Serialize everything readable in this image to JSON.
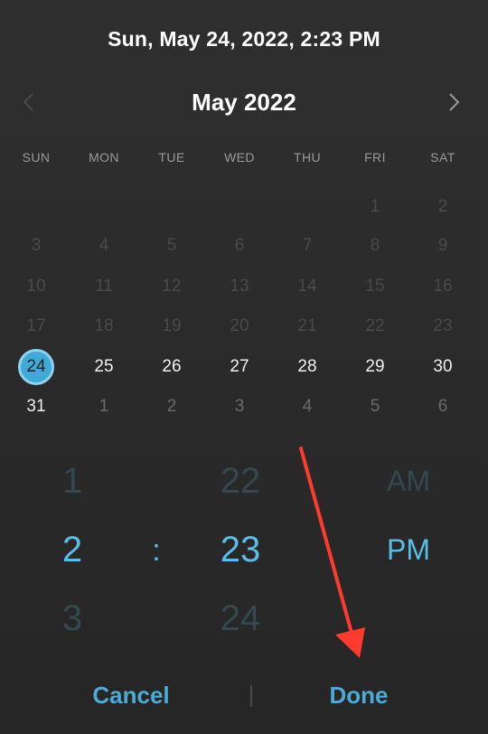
{
  "header": {
    "selected_datetime": "Sun, May 24, 2022, 2:23 PM"
  },
  "calendar": {
    "month_title": "May 2022",
    "weekdays": [
      "SUN",
      "MON",
      "TUE",
      "WED",
      "THU",
      "FRI",
      "SAT"
    ],
    "weeks": [
      [
        {
          "d": "",
          "s": "empty"
        },
        {
          "d": "",
          "s": "empty"
        },
        {
          "d": "",
          "s": "empty"
        },
        {
          "d": "",
          "s": "empty"
        },
        {
          "d": "",
          "s": "empty"
        },
        {
          "d": "1",
          "s": "dim"
        },
        {
          "d": "2",
          "s": "dim"
        }
      ],
      [
        {
          "d": "3",
          "s": "dim"
        },
        {
          "d": "4",
          "s": "dim"
        },
        {
          "d": "5",
          "s": "dim"
        },
        {
          "d": "6",
          "s": "dim"
        },
        {
          "d": "7",
          "s": "dim"
        },
        {
          "d": "8",
          "s": "dim"
        },
        {
          "d": "9",
          "s": "dim"
        }
      ],
      [
        {
          "d": "10",
          "s": "dim"
        },
        {
          "d": "11",
          "s": "dim"
        },
        {
          "d": "12",
          "s": "dim"
        },
        {
          "d": "13",
          "s": "dim"
        },
        {
          "d": "14",
          "s": "dim"
        },
        {
          "d": "15",
          "s": "dim"
        },
        {
          "d": "16",
          "s": "dim"
        }
      ],
      [
        {
          "d": "17",
          "s": "dim"
        },
        {
          "d": "18",
          "s": "dim"
        },
        {
          "d": "19",
          "s": "dim"
        },
        {
          "d": "20",
          "s": "dim"
        },
        {
          "d": "21",
          "s": "dim"
        },
        {
          "d": "22",
          "s": "dim"
        },
        {
          "d": "23",
          "s": "dim"
        }
      ],
      [
        {
          "d": "24",
          "s": "selected"
        },
        {
          "d": "25",
          "s": "active"
        },
        {
          "d": "26",
          "s": "active"
        },
        {
          "d": "27",
          "s": "active"
        },
        {
          "d": "28",
          "s": "active"
        },
        {
          "d": "29",
          "s": "active"
        },
        {
          "d": "30",
          "s": "active"
        }
      ],
      [
        {
          "d": "31",
          "s": "active"
        },
        {
          "d": "1",
          "s": "overflow"
        },
        {
          "d": "2",
          "s": "overflow"
        },
        {
          "d": "3",
          "s": "overflow"
        },
        {
          "d": "4",
          "s": "overflow"
        },
        {
          "d": "5",
          "s": "overflow"
        },
        {
          "d": "6",
          "s": "overflow"
        }
      ]
    ]
  },
  "time_picker": {
    "hour_prev": "1",
    "hour": "2",
    "hour_next": "3",
    "separator": ":",
    "minute_prev": "22",
    "minute": "23",
    "minute_next": "24",
    "ampm_prev": "AM",
    "ampm": "PM"
  },
  "footer": {
    "cancel_label": "Cancel",
    "done_label": "Done"
  },
  "colors": {
    "accent": "#3fa9d8",
    "annotation_arrow": "#ff3b2f"
  },
  "icons": {
    "prev": "chevron-left-icon",
    "next": "chevron-right-icon"
  }
}
